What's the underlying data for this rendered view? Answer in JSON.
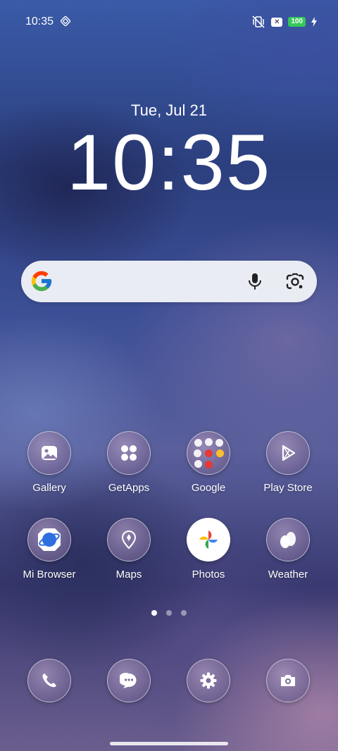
{
  "status_bar": {
    "time": "10:35",
    "battery": "100",
    "icons": [
      "status-logo-icon",
      "mute-vibrate-icon",
      "x-notification-icon",
      "charging-bolt-icon"
    ]
  },
  "clock": {
    "date": "Tue, Jul 21",
    "time": "10:35"
  },
  "search": {
    "icons": [
      "google-logo-icon",
      "mic-icon",
      "google-lens-icon"
    ]
  },
  "apps_row1": [
    {
      "label": "Gallery",
      "icon": "gallery-icon"
    },
    {
      "label": "GetApps",
      "icon": "getapps-icon"
    },
    {
      "label": "Google",
      "icon": "google-folder-icon"
    },
    {
      "label": "Play Store",
      "icon": "play-store-icon"
    }
  ],
  "apps_row2": [
    {
      "label": "Mi Browser",
      "icon": "mi-browser-icon"
    },
    {
      "label": "Maps",
      "icon": "maps-icon"
    },
    {
      "label": "Photos",
      "icon": "photos-icon"
    },
    {
      "label": "Weather",
      "icon": "weather-icon"
    }
  ],
  "dock": [
    {
      "icon": "phone-icon"
    },
    {
      "icon": "messages-icon"
    },
    {
      "icon": "settings-icon"
    },
    {
      "icon": "camera-icon"
    }
  ],
  "pager": {
    "pages": 3,
    "active": 1
  }
}
